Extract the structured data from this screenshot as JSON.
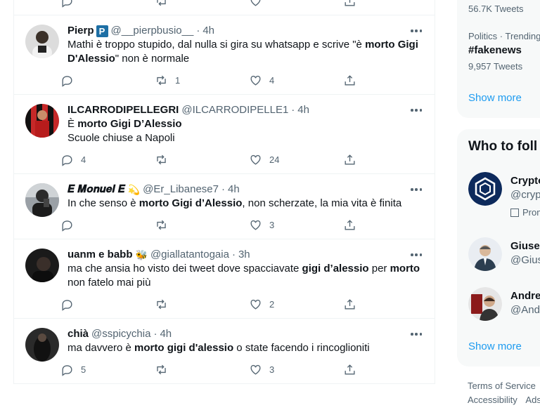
{
  "tweets": [
    {
      "name": "Pierp",
      "badge": "P",
      "handle": "@__pierpbusio__",
      "time": "4h",
      "text": [
        {
          "t": "Mathi è troppo stupido, dal nulla si gira su whatsapp e scrive \"è ",
          "b": false
        },
        {
          "t": "morto Gigi D'Alessio",
          "b": true
        },
        {
          "t": "\" non è normale",
          "b": false
        }
      ],
      "replies": "",
      "retweets": "1",
      "likes": "4"
    },
    {
      "name": "ILCARRODIPELLEGRI",
      "handle": "@ILCARRODIPELLE1",
      "time": "4h",
      "text": [
        {
          "t": "È ",
          "b": false
        },
        {
          "t": "morto Gigi D’Alessio",
          "b": true
        },
        {
          "t": "\nScuole chiuse a Napoli",
          "b": false
        }
      ],
      "replies": "4",
      "retweets": "",
      "likes": "24"
    },
    {
      "name": "𝑬 𝑴𝒐𝒏𝒖𝒆𝒍 𝑬",
      "handle": "@Er_Libanese7",
      "time": "4h",
      "emoji": "💫",
      "text": [
        {
          "t": "In che senso è ",
          "b": false
        },
        {
          "t": "morto Gigi d’Alessio",
          "b": true
        },
        {
          "t": ", non scherzate, la mia vita è finita",
          "b": false
        }
      ],
      "replies": "",
      "retweets": "",
      "likes": "3"
    },
    {
      "name": "uanm e babb",
      "handle": "@giallatantogaia",
      "time": "3h",
      "emoji": "🐝",
      "text": [
        {
          "t": "ma che ansia ho visto dei tweet dove spacciavate ",
          "b": false
        },
        {
          "t": "gigi d’alessio",
          "b": true
        },
        {
          "t": " per ",
          "b": false
        },
        {
          "t": "morto",
          "b": true
        },
        {
          "t": "\nnon fatelo mai più",
          "b": false
        }
      ],
      "replies": "",
      "retweets": "",
      "likes": "2"
    },
    {
      "name": "chià",
      "handle": "@sspicychia",
      "time": "4h",
      "text": [
        {
          "t": "ma davvero è ",
          "b": false
        },
        {
          "t": "morto gigi d'alessio",
          "b": true
        },
        {
          "t": " o state facendo i rincoglioniti",
          "b": false
        }
      ],
      "replies": "5",
      "retweets": "",
      "likes": "3"
    }
  ],
  "sidebar": {
    "trend1_count": "56.7K Tweets",
    "trend2_context": "Politics · Trending",
    "trend2_tag": "#fakenews",
    "trend2_count": "9,957 Tweets",
    "show_more": "Show more",
    "who_to_follow": "Who to foll",
    "follow": [
      {
        "name": "Crypto",
        "handle": "@cryp",
        "promoted": "Prom"
      },
      {
        "name": "Giusep",
        "handle": "@Gius"
      },
      {
        "name": "Andre",
        "handle": "@Andr"
      }
    ],
    "show_more_2": "Show more"
  },
  "footer": {
    "terms": "Terms of Service",
    "accessibility": "Accessibility",
    "ads": "Ads"
  },
  "colors": {
    "accent": "#1d9bf0",
    "muted": "#536471",
    "border": "#eff3f4",
    "card": "#f7f9f9"
  }
}
